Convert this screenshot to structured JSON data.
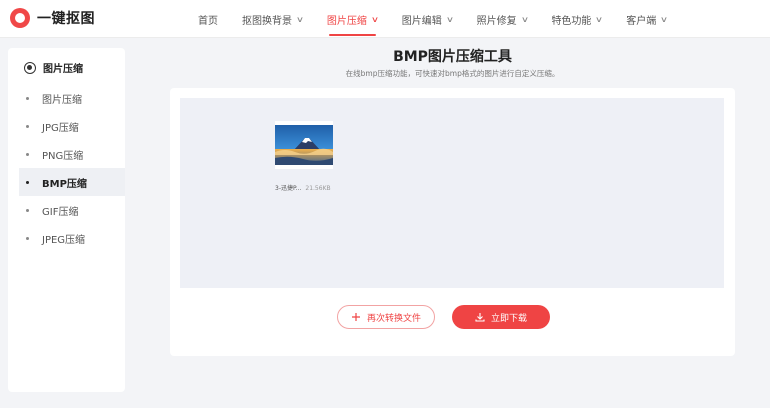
{
  "brand": {
    "name": "一键抠图",
    "logo_icon": "logo-ring-icon",
    "accent": "#ef4444"
  },
  "nav": {
    "items": [
      {
        "label": "首页",
        "has_dropdown": false,
        "active": false
      },
      {
        "label": "抠图换背景",
        "has_dropdown": true,
        "active": false
      },
      {
        "label": "图片压缩",
        "has_dropdown": true,
        "active": true
      },
      {
        "label": "图片编辑",
        "has_dropdown": true,
        "active": false
      },
      {
        "label": "照片修复",
        "has_dropdown": true,
        "active": false
      },
      {
        "label": "特色功能",
        "has_dropdown": true,
        "active": false
      },
      {
        "label": "客户端",
        "has_dropdown": true,
        "active": false
      }
    ]
  },
  "sidebar": {
    "header": "图片压缩",
    "items": [
      {
        "label": "图片压缩",
        "active": false
      },
      {
        "label": "JPG压缩",
        "active": false
      },
      {
        "label": "PNG压缩",
        "active": false
      },
      {
        "label": "BMP压缩",
        "active": true
      },
      {
        "label": "GIF压缩",
        "active": false
      },
      {
        "label": "JPEG压缩",
        "active": false
      }
    ]
  },
  "main": {
    "title": "BMP图片压缩工具",
    "subtitle": "在线bmp压缩功能，可快速对bmp格式的图片进行自定义压缩。",
    "file": {
      "name": "3-迅捷P...",
      "size": "21.56KB"
    },
    "buttons": {
      "again": "再次转换文件",
      "download": "立即下载"
    }
  }
}
